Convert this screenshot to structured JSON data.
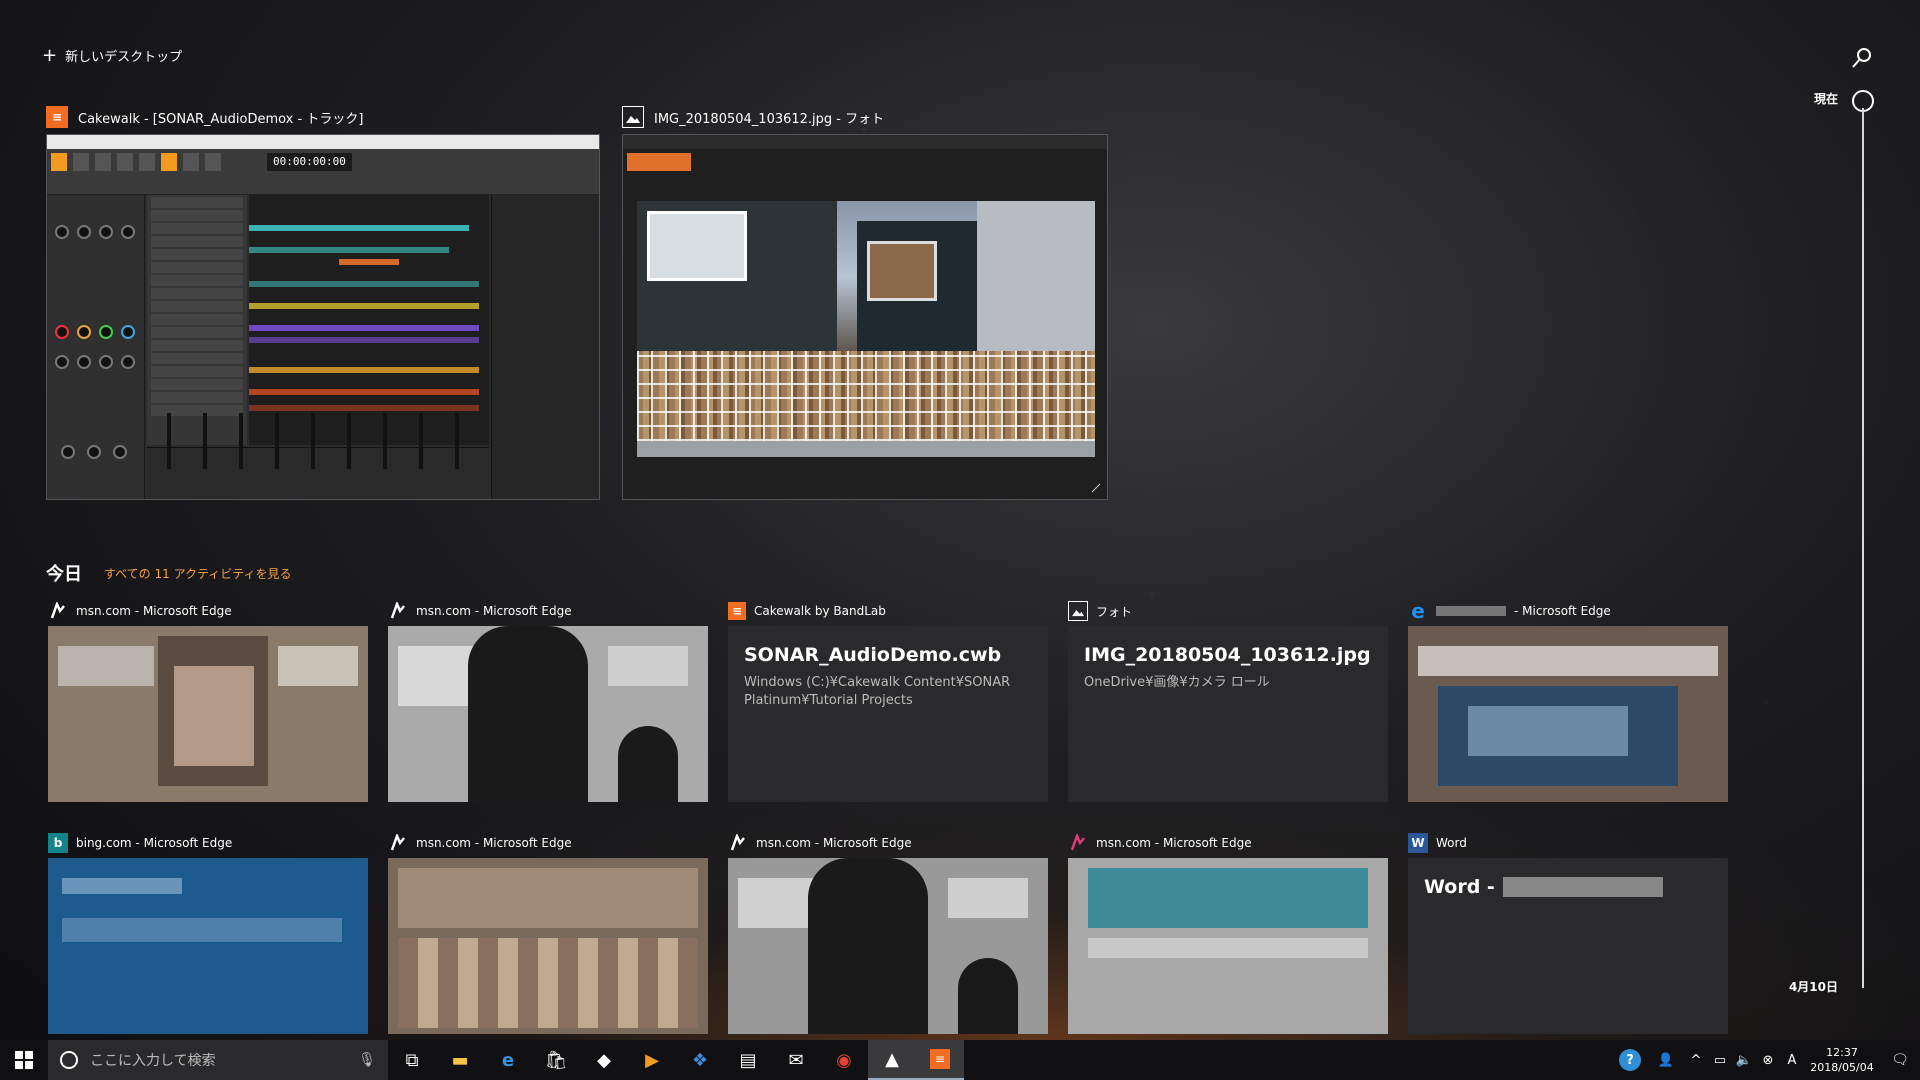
{
  "topbar": {
    "new_desktop_label": "新しいデスクトップ"
  },
  "timeline": {
    "now_label": "現在",
    "date_label": "4月10日"
  },
  "windows": [
    {
      "title": "Cakewalk - [SONAR_AudioDemox - トラック]",
      "icon": "cakewalk-icon",
      "transport_time": "00:00:00:00",
      "accent": "#f26d21"
    },
    {
      "title": "IMG_20180504_103612.jpg - フォト",
      "icon": "photos-icon"
    }
  ],
  "today": {
    "title": "今日",
    "see_all": "すべての 11 アクティビティを見る",
    "cards": [
      {
        "app": "msn.com - Microsoft Edge",
        "icon": "msn-icon"
      },
      {
        "app": "msn.com - Microsoft Edge",
        "icon": "msn-icon"
      },
      {
        "app": "Cakewalk by BandLab",
        "icon": "cakewalk-icon",
        "title": "SONAR_AudioDemo.cwb",
        "subtitle": "Windows (C:)¥Cakewalk Content¥SONAR Platinum¥Tutorial Projects"
      },
      {
        "app": "フォト",
        "icon": "photos-icon",
        "title": "IMG_20180504_103612.jpg",
        "subtitle": "OneDrive¥画像¥カメラ ロール"
      },
      {
        "app": "- Microsoft Edge",
        "icon": "edge-icon"
      },
      {
        "app": "bing.com - Microsoft Edge",
        "icon": "bing-icon"
      },
      {
        "app": "msn.com - Microsoft Edge",
        "icon": "msn-icon"
      },
      {
        "app": "msn.com - Microsoft Edge",
        "icon": "msn-icon"
      },
      {
        "app": "msn.com - Microsoft Edge",
        "icon": "msn-icon-pink"
      },
      {
        "app": "Word",
        "icon": "word-icon",
        "title": "Word -"
      }
    ]
  },
  "taskbar": {
    "search_placeholder": "ここに入力して検索",
    "time": "12:37",
    "date": "2018/05/04"
  },
  "colors": {
    "accent_orange": "#f5a142",
    "cakewalk": "#f26d21",
    "edge_blue": "#1e73be",
    "word_blue": "#2b579a",
    "bing_blue": "#1d5b8e"
  }
}
